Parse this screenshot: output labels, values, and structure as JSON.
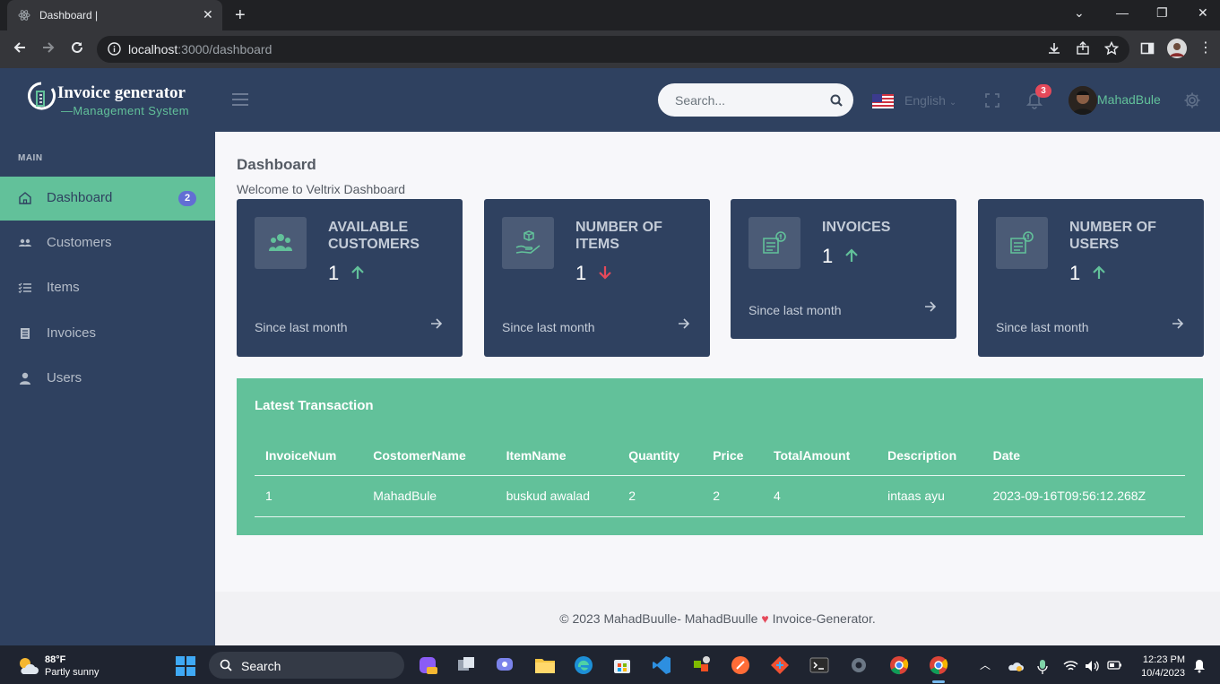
{
  "browser": {
    "tab_title": "Dashboard |",
    "url_host": "localhost",
    "url_path": ":3000/dashboard"
  },
  "header": {
    "logo_title": "Invoice generator",
    "logo_subtitle": "—Management System",
    "search_placeholder": "Search...",
    "language": "English",
    "notification_count": "3",
    "username": "MahadBule"
  },
  "sidebar": {
    "section": "MAIN",
    "items": [
      {
        "label": "Dashboard",
        "icon": "home-icon",
        "badge": "2",
        "active": true
      },
      {
        "label": "Customers",
        "icon": "users-icon"
      },
      {
        "label": "Items",
        "icon": "list-icon"
      },
      {
        "label": "Invoices",
        "icon": "document-icon"
      },
      {
        "label": "Users",
        "icon": "user-icon"
      }
    ]
  },
  "main": {
    "title": "Dashboard",
    "subtitle": "Welcome to Veltrix Dashboard",
    "cards": [
      {
        "title": "AVAILABLE CUSTOMERS",
        "value": "1",
        "trend": "up",
        "footer": "Since last month"
      },
      {
        "title": "NUMBER OF ITEMS",
        "value": "1",
        "trend": "down",
        "footer": "Since last month"
      },
      {
        "title": "INVOICES",
        "value": "1",
        "trend": "up",
        "footer": "Since last month"
      },
      {
        "title": "NUMBER OF USERS",
        "value": "1",
        "trend": "up",
        "footer": "Since last month"
      }
    ],
    "transactions": {
      "title": "Latest Transaction",
      "columns": [
        "InvoiceNum",
        "CostomerName",
        "ItemName",
        "Quantity",
        "Price",
        "TotalAmount",
        "Description",
        "Date"
      ],
      "rows": [
        [
          "1",
          "MahadBule",
          "buskud awalad",
          "2",
          "2",
          "4",
          "intaas ayu",
          "2023-09-16T09:56:12.268Z"
        ]
      ]
    }
  },
  "footer": {
    "left": "© 2023 MahadBuulle- MahadBuulle",
    "right": "Invoice-Generator."
  },
  "taskbar": {
    "temp": "88°F",
    "weather": "Partly sunny",
    "search": "Search",
    "time": "12:23 PM",
    "date": "10/4/2023"
  },
  "colors": {
    "navy": "#2f4160",
    "green": "#62c19a",
    "red": "#e5495a",
    "badge": "#626ed4"
  }
}
